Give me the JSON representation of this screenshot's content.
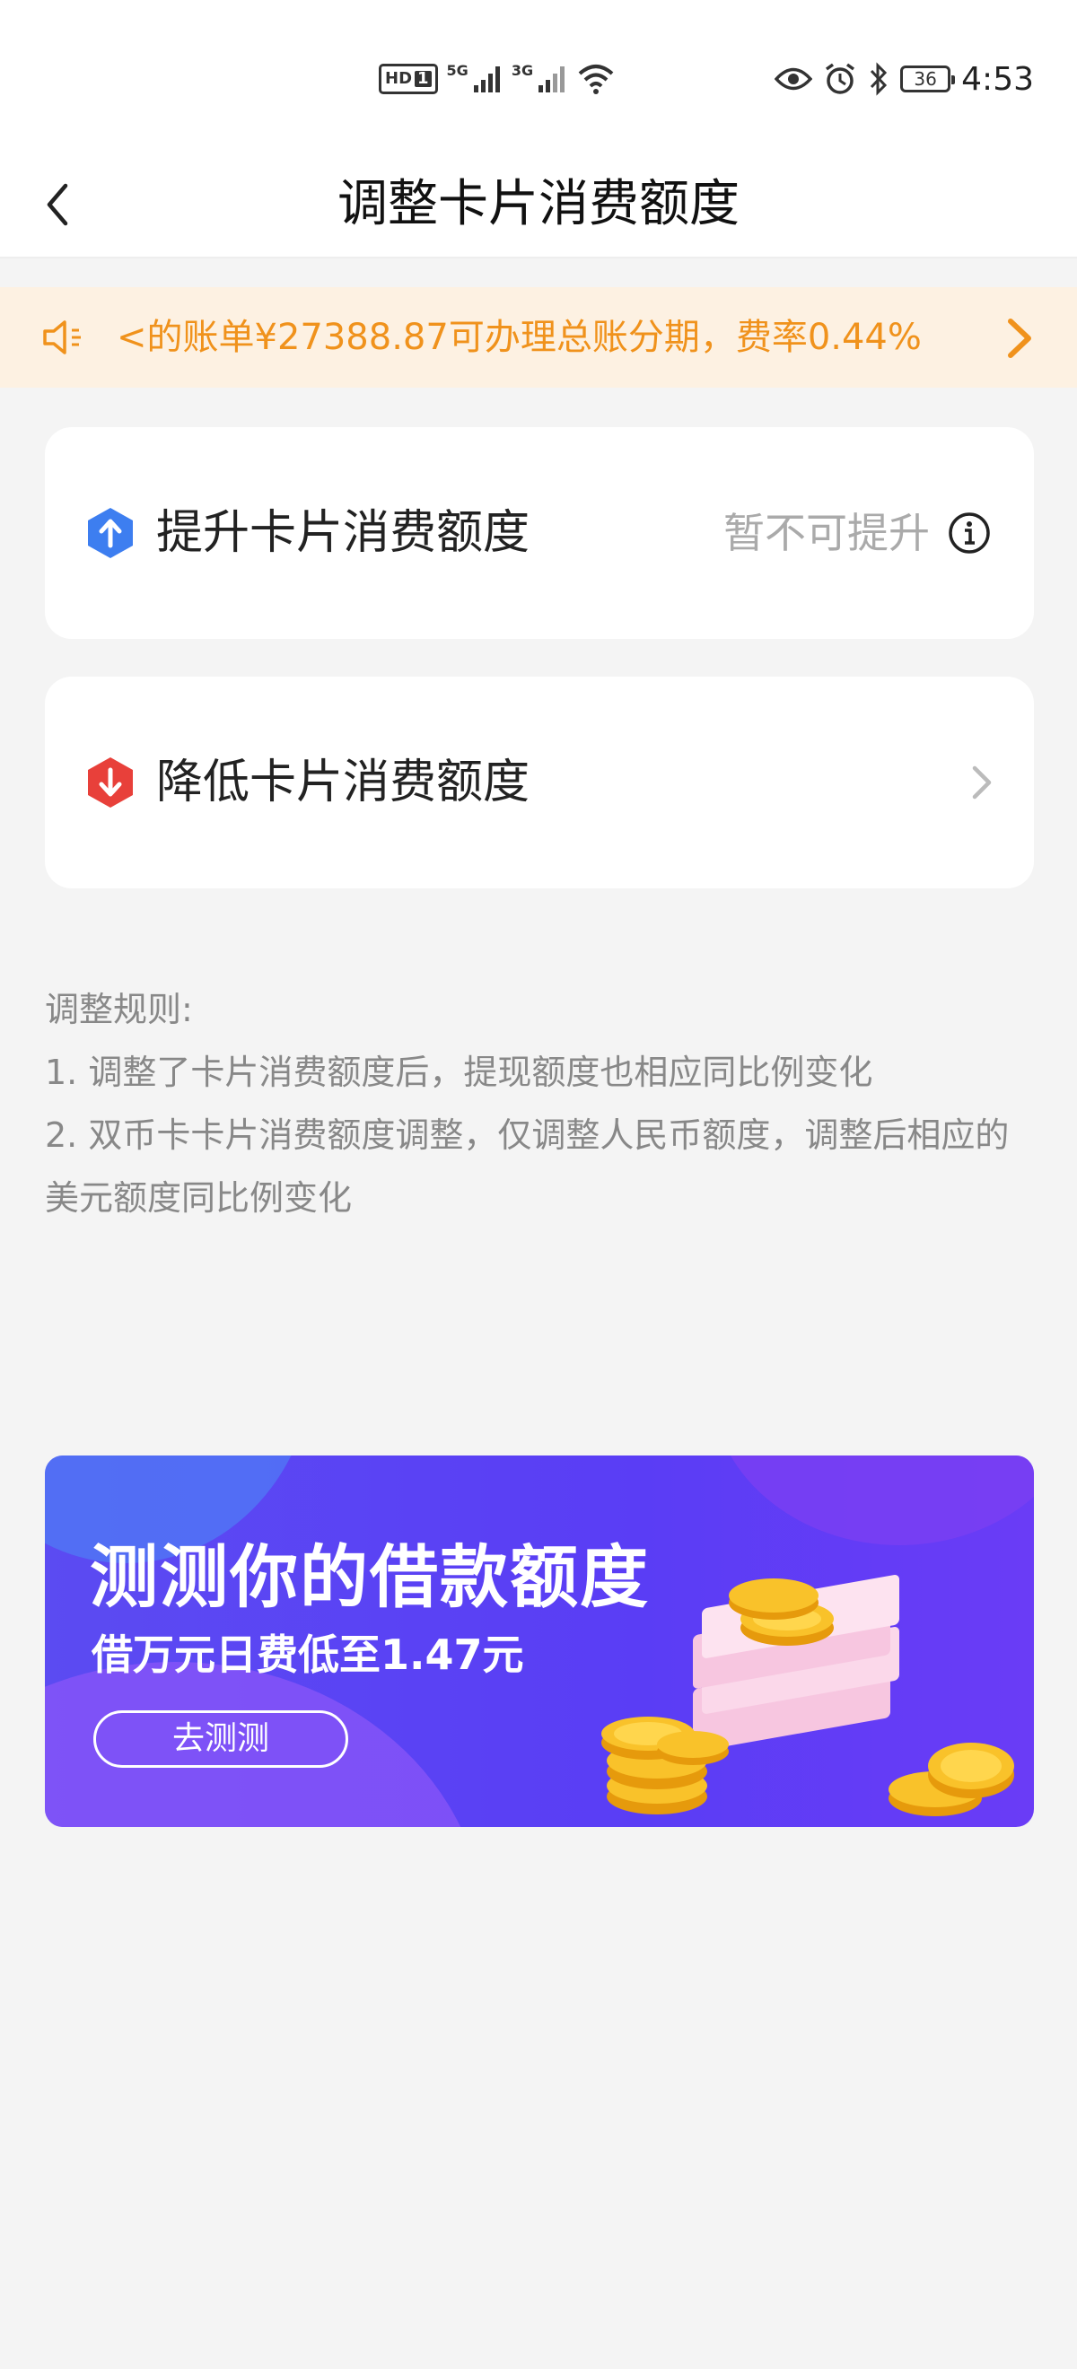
{
  "status_bar": {
    "hd_label": "HD",
    "sim_number": "1",
    "net1": "5G",
    "net2": "3G",
    "battery": "36",
    "time": "4:53"
  },
  "nav": {
    "title": "调整卡片消费额度",
    "back_icon": "chevron-left-icon"
  },
  "notice": {
    "text": "<的账单¥27388.87可办理总账分期，费率0.44%",
    "color": "#f0921c",
    "background": "#fdf1e2"
  },
  "cards": {
    "raise": {
      "label": "提升卡片消费额度",
      "status": "暂不可提升",
      "icon": "arrow-up-icon",
      "icon_color": "#3d7ef0"
    },
    "lower": {
      "label": "降低卡片消费额度",
      "icon": "arrow-down-icon",
      "icon_color": "#e8403a"
    }
  },
  "rules": {
    "title": "调整规则:",
    "items": [
      "1. 调整了卡片消费额度后，提现额度也相应同比例变化",
      "2. 双币卡卡片消费额度调整，仅调整人民币额度，调整后相应的美元额度同比例变化"
    ]
  },
  "banner": {
    "title": "测测你的借款额度",
    "subtitle": "借万元日费低至1.47元",
    "button": "去测测",
    "background": "#5a3df5"
  }
}
